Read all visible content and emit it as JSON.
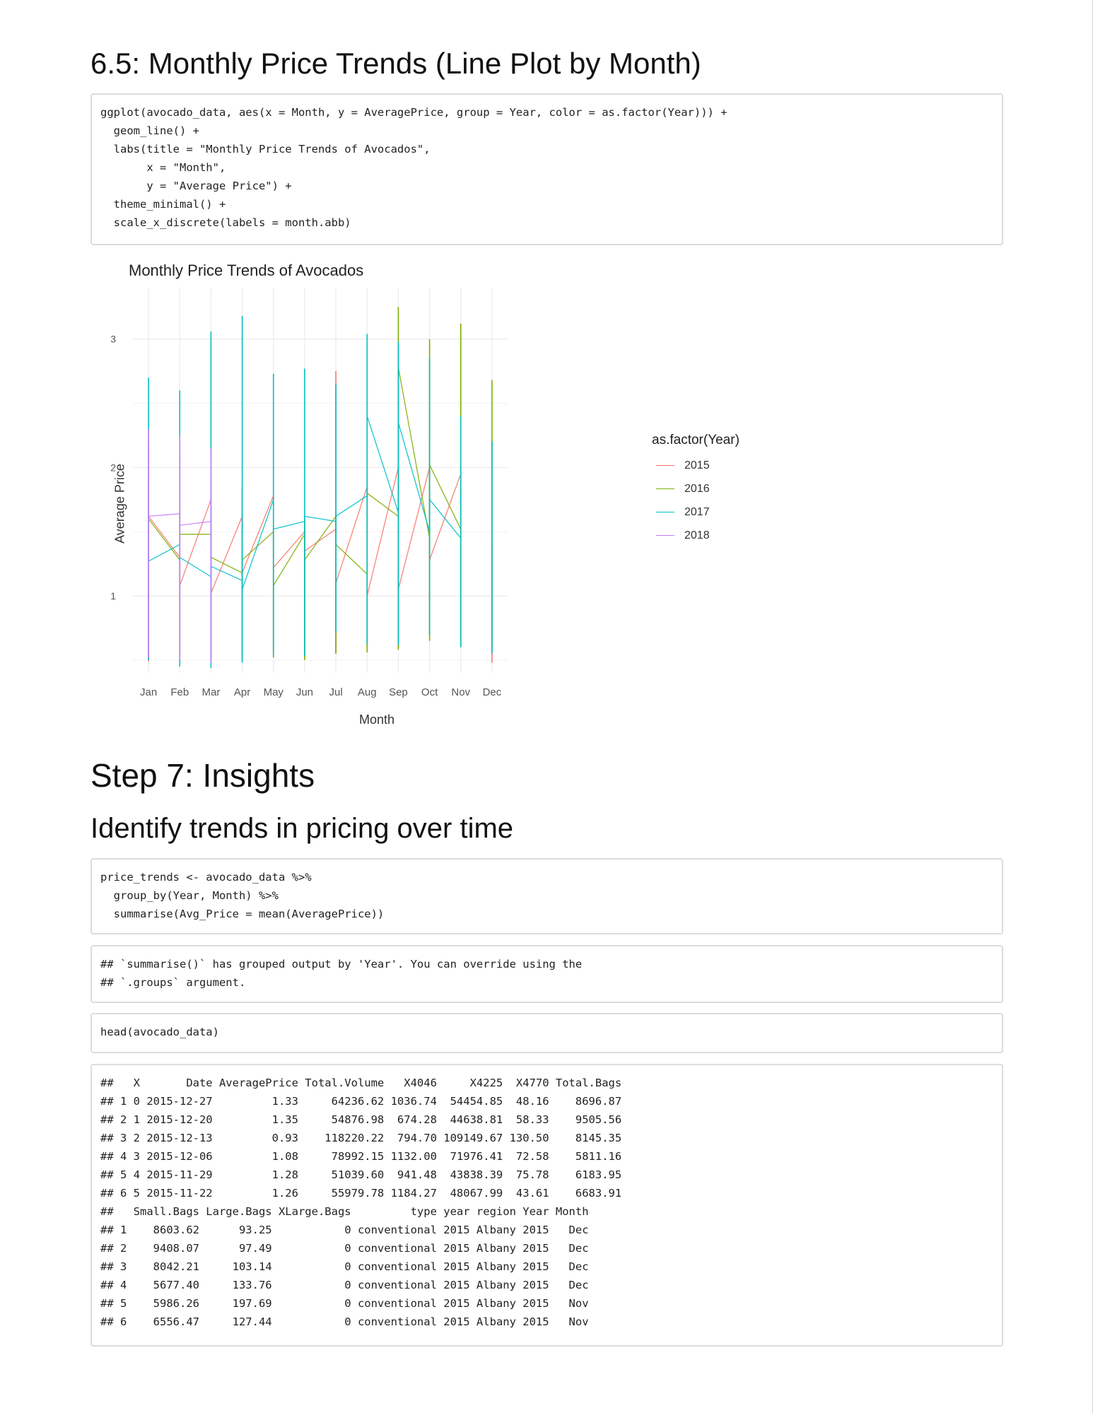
{
  "section_65": {
    "heading": "6.5: Monthly Price Trends (Line Plot by Month)"
  },
  "code_ggplot": {
    "lines": [
      "ggplot(avocado_data, aes(x = Month, y = AveragePrice, group = Year, color = as.factor(Year))) +",
      "  geom_line() +",
      "  labs(title = \"Monthly Price Trends of Avocados\",",
      "       x = \"Month\",",
      "       y = \"Average Price\") +",
      "  theme_minimal() +",
      "  scale_x_discrete(labels = month.abb)"
    ]
  },
  "chart_data": {
    "type": "line",
    "title": "Monthly Price Trends of Avocados",
    "xlabel": "Month",
    "ylabel": "Average Price",
    "categories": [
      "Jan",
      "Feb",
      "Mar",
      "Apr",
      "May",
      "Jun",
      "Jul",
      "Aug",
      "Sep",
      "Oct",
      "Nov",
      "Dec"
    ],
    "yticks": [
      1,
      2,
      3
    ],
    "ylim": [
      0.4,
      3.4
    ],
    "grid": true,
    "legend": {
      "title": "as.factor(Year)",
      "placement": "right"
    },
    "series": [
      {
        "name": "2015",
        "color": "#F8766D",
        "ranges": [
          [
            0.49,
            2.2
          ],
          [
            0.54,
            2.1
          ],
          [
            0.55,
            1.9
          ],
          [
            0.55,
            1.85
          ],
          [
            0.54,
            1.55
          ],
          [
            0.52,
            1.55
          ],
          [
            0.55,
            2.75
          ],
          [
            0.6,
            1.95
          ],
          [
            0.6,
            1.95
          ],
          [
            0.7,
            2.25
          ],
          [
            0.6,
            1.95
          ],
          [
            0.48,
            1.4
          ]
        ],
        "path": [
          1.62,
          1.3,
          1.08,
          1.75,
          1.02,
          1.62,
          1.18,
          1.78,
          1.22,
          1.5,
          1.35,
          1.52,
          1.1,
          1.85,
          1.0,
          2.0,
          1.05,
          2.0,
          1.28,
          1.95,
          1.3
        ]
      },
      {
        "name": "2016",
        "color": "#7CAE00",
        "ranges": [
          [
            0.54,
            1.9
          ],
          [
            0.52,
            1.7
          ],
          [
            0.52,
            1.6
          ],
          [
            0.5,
            1.55
          ],
          [
            0.52,
            1.5
          ],
          [
            0.5,
            1.6
          ],
          [
            0.55,
            1.65
          ],
          [
            0.56,
            1.85
          ],
          [
            0.58,
            3.25
          ],
          [
            0.65,
            3.0
          ],
          [
            0.6,
            3.12
          ],
          [
            0.6,
            2.68
          ]
        ],
        "path": [
          1.6,
          1.28,
          1.48,
          1.48,
          1.3,
          1.18,
          1.28,
          1.5,
          1.08,
          1.48,
          1.28,
          1.62,
          1.4,
          1.17,
          1.8,
          1.62,
          2.78,
          1.45,
          2.02,
          1.52
        ]
      },
      {
        "name": "2017",
        "color": "#00BFC4",
        "ranges": [
          [
            0.5,
            2.7
          ],
          [
            0.45,
            2.6
          ],
          [
            0.44,
            3.06
          ],
          [
            0.48,
            3.18
          ],
          [
            0.54,
            2.73
          ],
          [
            0.53,
            2.77
          ],
          [
            0.72,
            2.65
          ],
          [
            0.63,
            3.04
          ],
          [
            0.62,
            2.98
          ],
          [
            0.7,
            2.85
          ],
          [
            0.6,
            2.4
          ],
          [
            0.55,
            2.2
          ]
        ],
        "path": [
          1.27,
          1.4,
          1.3,
          1.15,
          1.23,
          1.12,
          1.05,
          1.75,
          1.52,
          1.58,
          1.62,
          1.58,
          1.62,
          1.78,
          2.4,
          1.65,
          2.35,
          1.5,
          1.75,
          1.45
        ]
      },
      {
        "name": "2018",
        "color": "#C77CFF",
        "ranges": [
          [
            0.52,
            2.3
          ],
          [
            0.5,
            2.25
          ],
          [
            0.48,
            2.15
          ]
        ],
        "path": [
          1.62,
          1.64,
          1.55,
          1.58
        ]
      }
    ]
  },
  "section_7": {
    "heading": "Step 7: Insights"
  },
  "subsection_trends": {
    "heading": "Identify trends in pricing over time"
  },
  "code_price_trends": {
    "lines": [
      "price_trends <- avocado_data %>%",
      "  group_by(Year, Month) %>%",
      "  summarise(Avg_Price = mean(AveragePrice))"
    ]
  },
  "output_summarise": {
    "lines": [
      "## `summarise()` has grouped output by 'Year'. You can override using the",
      "## `.groups` argument."
    ]
  },
  "code_head": {
    "lines": [
      "head(avocado_data)"
    ]
  },
  "output_head": {
    "lines": [
      "##   X       Date AveragePrice Total.Volume   X4046     X4225  X4770 Total.Bags",
      "## 1 0 2015-12-27         1.33     64236.62 1036.74  54454.85  48.16    8696.87",
      "## 2 1 2015-12-20         1.35     54876.98  674.28  44638.81  58.33    9505.56",
      "## 3 2 2015-12-13         0.93    118220.22  794.70 109149.67 130.50    8145.35",
      "## 4 3 2015-12-06         1.08     78992.15 1132.00  71976.41  72.58    5811.16",
      "## 5 4 2015-11-29         1.28     51039.60  941.48  43838.39  75.78    6183.95",
      "## 6 5 2015-11-22         1.26     55979.78 1184.27  48067.99  43.61    6683.91",
      "##   Small.Bags Large.Bags XLarge.Bags         type year region Year Month",
      "## 1    8603.62      93.25           0 conventional 2015 Albany 2015   Dec",
      "## 2    9408.07      97.49           0 conventional 2015 Albany 2015   Dec",
      "## 3    8042.21     103.14           0 conventional 2015 Albany 2015   Dec",
      "## 4    5677.40     133.76           0 conventional 2015 Albany 2015   Dec",
      "## 5    5986.26     197.69           0 conventional 2015 Albany 2015   Nov",
      "## 6    6556.47     127.44           0 conventional 2015 Albany 2015   Nov"
    ]
  }
}
